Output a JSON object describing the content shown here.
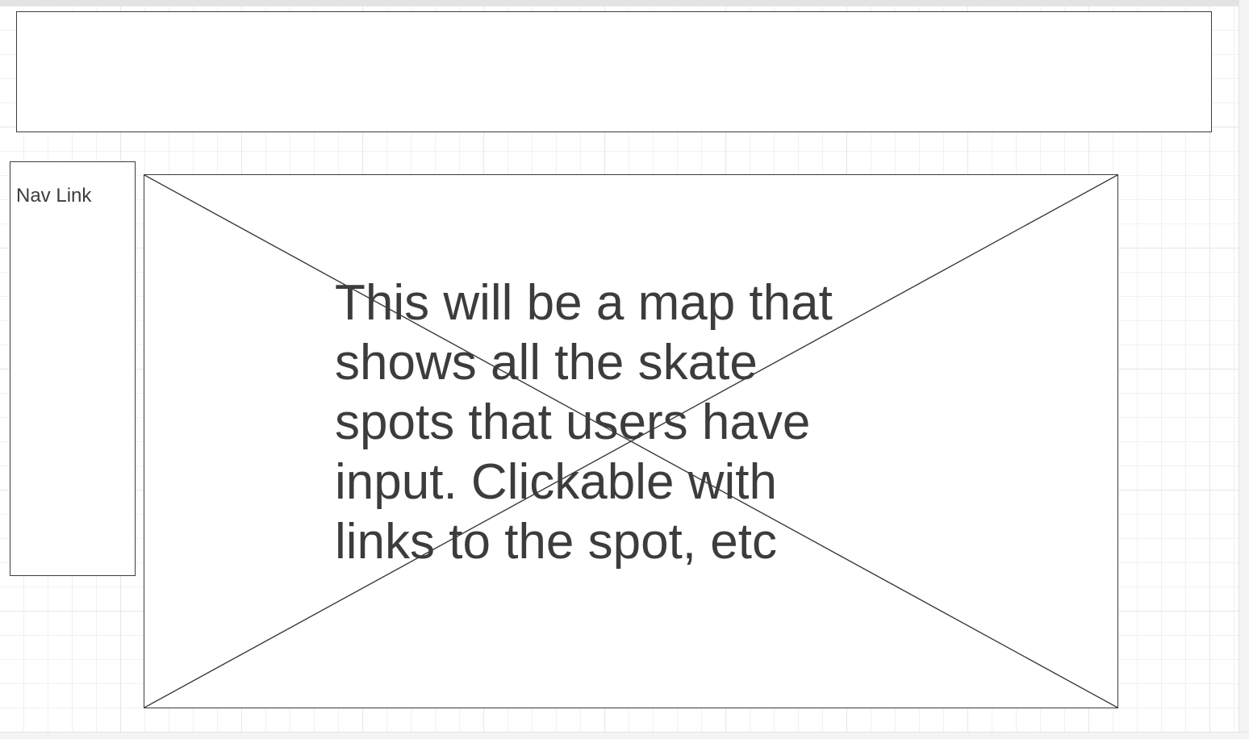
{
  "colors": {
    "stroke": "#3c3c3c",
    "text": "#3c3c3c",
    "grid": "#e6e6e6",
    "background": "#ffffff"
  },
  "nav": {
    "link_label": "Nav Link"
  },
  "map_placeholder": {
    "description": "This will be a map that shows all the skate spots that users have input. Clickable with links to the spot, etc",
    "icon": "image-placeholder-cross-icon"
  }
}
